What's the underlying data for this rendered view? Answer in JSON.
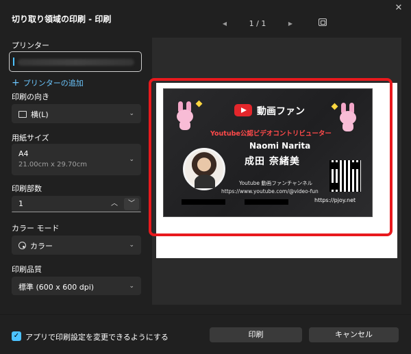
{
  "window": {
    "title": "切り取り領域の印刷 - 印刷",
    "close_glyph": "✕"
  },
  "pager": {
    "prev_glyph": "◀",
    "next_glyph": "▶",
    "page_text": "1 / 1"
  },
  "printer": {
    "label": "プリンター",
    "value": "",
    "add_label": "プリンターの追加",
    "add_glyph": "+"
  },
  "orientation": {
    "label": "印刷の向き",
    "value": "横(L)"
  },
  "paper_size": {
    "label": "用紙サイズ",
    "value": "A4",
    "detail": "21.00cm x 29.70cm"
  },
  "copies": {
    "label": "印刷部数",
    "value": "1",
    "up_glyph": "︿",
    "down_glyph": "﹀"
  },
  "color_mode": {
    "label": "カラー モード",
    "value": "カラー"
  },
  "quality": {
    "label": "印刷品質",
    "value": "標準 (600 x 600 dpi)"
  },
  "chevron_glyph": "⌄",
  "preview_card": {
    "brand": "動画ファン",
    "official": "Youtube公認ビデオコントリビューター",
    "name_en": "Naomi Narita",
    "name_ja": "成田 奈緒美",
    "channel": "Youtube 動画ファンチャンネル",
    "url": "https://www.youtube.com/@video-fun",
    "site": "https://pjoy.net"
  },
  "footer": {
    "checkbox_label": "アプリで印刷設定を変更できるようにする",
    "checkbox_checked": true,
    "check_glyph": "✓",
    "print_label": "印刷",
    "cancel_label": "キャンセル"
  },
  "colors": {
    "accent": "#4cc2ff",
    "highlight": "#e8191d",
    "background": "#202020"
  },
  "icons": [
    "close-icon",
    "prev-page-icon",
    "next-page-icon",
    "fit-page-icon",
    "plus-icon",
    "orientation-icon",
    "palette-icon",
    "chevron-down-icon",
    "chevron-up-icon",
    "checkmark-icon"
  ]
}
